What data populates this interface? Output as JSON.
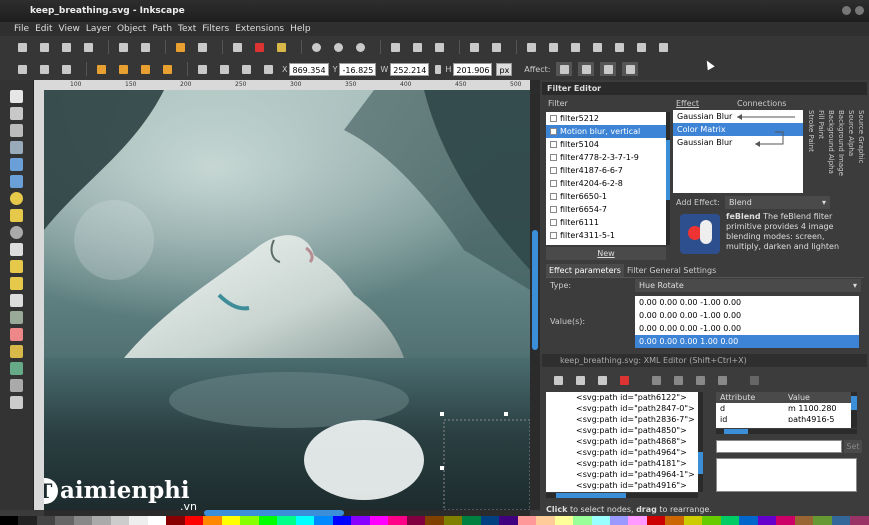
{
  "window": {
    "title": "keep_breathing.svg - Inkscape"
  },
  "menu": [
    "File",
    "Edit",
    "View",
    "Layer",
    "Object",
    "Path",
    "Text",
    "Filters",
    "Extensions",
    "Help"
  ],
  "toolbar": {
    "x_label": "X",
    "x_value": "869.354",
    "y_label": "Y",
    "y_value": "-16.825",
    "w_label": "W",
    "w_value": "252.214",
    "h_label": "H",
    "h_value": "201.906",
    "unit": "px",
    "affect_label": "Affect:"
  },
  "ruler_ticks": [
    "100",
    "150",
    "200",
    "250",
    "300",
    "350",
    "400",
    "450",
    "500"
  ],
  "filter_editor": {
    "title": "Filter Editor",
    "filter_col": "Filter",
    "filters": [
      "filter5212",
      "Motion blur, vertical",
      "filter5104",
      "filter4778-2-3-7-1-9",
      "filter4187-6-6-7",
      "filter4204-6-2-8",
      "filter6650-1",
      "filter6654-7",
      "filter6111",
      "filter4311-5-1"
    ],
    "selected_filter": 1,
    "new_label": "New",
    "effect_col": "Effect",
    "connections_col": "Connections",
    "effects": [
      "Gaussian Blur",
      "Color Matrix",
      "Gaussian Blur"
    ],
    "selected_effect": 1,
    "connection_labels": [
      "Stroke Paint",
      "Fill Paint",
      "Background Alpha",
      "Background Image",
      "Source Alpha",
      "Source Graphic"
    ],
    "add_effect_label": "Add Effect:",
    "add_effect_value": "Blend",
    "blend_desc_bold": "feBlend",
    "blend_desc": "The feBlend filter primitive provides 4 image blending modes: screen, multiply, darken and lighten",
    "tabs": [
      "Effect parameters",
      "Filter General Settings"
    ],
    "type_label": "Type:",
    "type_value": "Hue Rotate",
    "values_label": "Value(s):",
    "matrix": [
      "0.00 0.00 0.00 -1.00 0.00",
      "0.00 0.00 0.00 -1.00 0.00",
      "0.00 0.00 0.00 -1.00 0.00",
      "0.00 0.00 0.00 1.00 0.00"
    ],
    "selected_matrix_row": 3
  },
  "xml_editor": {
    "title": "keep_breathing.svg: XML Editor (Shift+Ctrl+X)",
    "nodes": [
      "<svg:path id=\"path6122\">",
      "<svg:path id=\"path2847-0\">",
      "<svg:path id=\"path2836-7\">",
      "<svg:path id=\"path4850\">",
      "<svg:path id=\"path4868\">",
      "<svg:path id=\"path4964\">",
      "<svg:path id=\"path4181\">",
      "<svg:path id=\"path4964-1\">",
      "<svg:path id=\"path4916\">"
    ],
    "attr_col": "Attribute",
    "value_col": "Value",
    "attrs": [
      {
        "name": "d",
        "value": "m 1100.280"
      },
      {
        "name": "id",
        "value": "path4916-5"
      }
    ],
    "set_label": "Set",
    "status_click": "Click",
    "status_mid": " to select nodes, ",
    "status_drag": "drag",
    "status_end": " to rearrange."
  },
  "watermark": {
    "brand": "aimienphi",
    "initial": "T",
    "tld": ".vn"
  },
  "colors": {
    "accent": "#3d84d6",
    "panel": "#3c3c3c",
    "title": "#1e1e1e"
  }
}
